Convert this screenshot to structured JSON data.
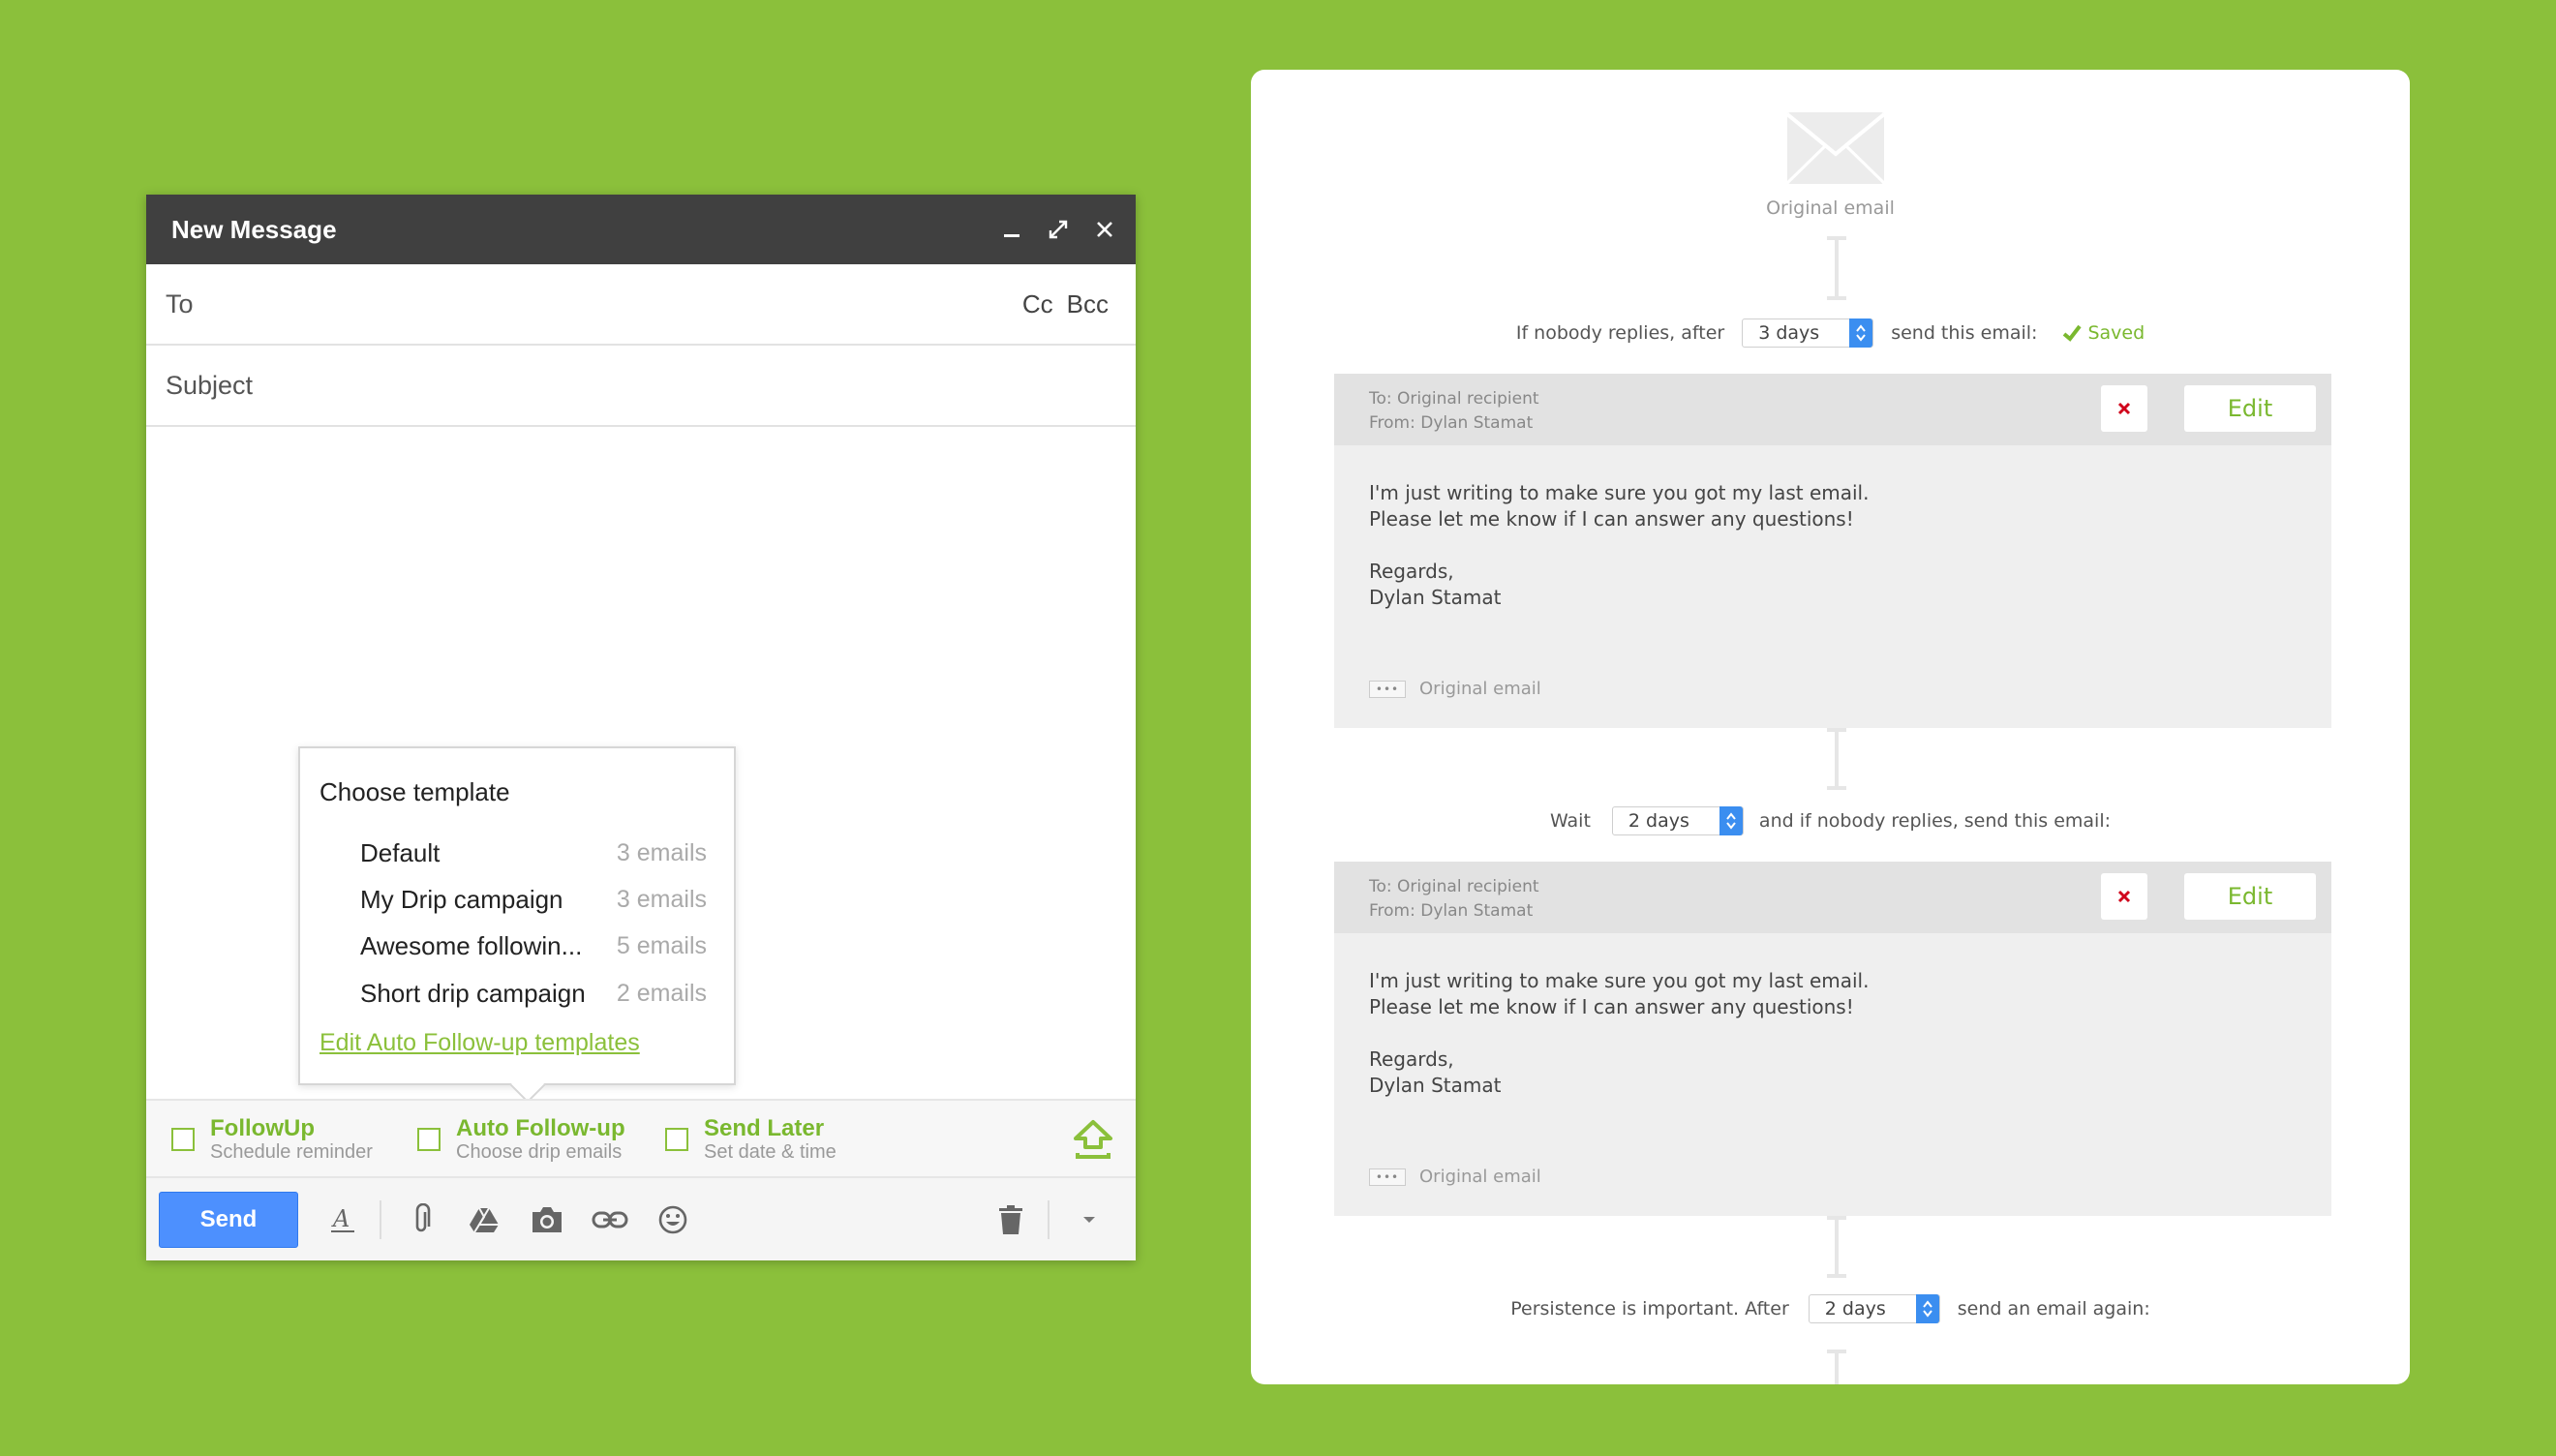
{
  "colors": {
    "background": "#8bc03b",
    "accent_green": "#7ab82f",
    "send_blue": "#4d90fe",
    "select_blue": "#3b8ef0",
    "delete_red": "#d0021b"
  },
  "compose": {
    "title": "New Message",
    "controls": [
      "minimize-icon",
      "expand-icon",
      "close-icon"
    ],
    "to_label": "To",
    "cc_label": "Cc",
    "bcc_label": "Bcc",
    "subject_placeholder": "Subject",
    "template_menu": {
      "title": "Choose template",
      "items": [
        {
          "name": "Default",
          "count": "3 emails"
        },
        {
          "name": "My Drip campaign",
          "count": "3 emails"
        },
        {
          "name": "Awesome followin...",
          "count": "5 emails"
        },
        {
          "name": "Short drip campaign",
          "count": "2 emails"
        }
      ],
      "edit_link": "Edit Auto Follow-up templates"
    },
    "options": [
      {
        "title": "FollowUp",
        "subtitle": "Schedule reminder"
      },
      {
        "title": "Auto Follow-up",
        "subtitle": "Choose drip emails"
      },
      {
        "title": "Send Later",
        "subtitle": "Set date & time"
      }
    ],
    "send_label": "Send",
    "toolbar_icons": [
      "text-format-icon",
      "attach-icon",
      "drive-icon",
      "photo-icon",
      "link-icon",
      "emoji-icon",
      "trash-icon",
      "more-options-icon"
    ]
  },
  "sequence": {
    "original_label": "Original email",
    "step1": {
      "before": "If nobody replies, after",
      "select": "3 days",
      "after": "send this email:",
      "saved": "Saved"
    },
    "email1": {
      "to": "To: Original recipient",
      "from": "From: Dylan Stamat",
      "edit": "Edit",
      "line1": "I'm just writing to make sure you got my last email.",
      "line2": "Please let me know if I can answer any questions!",
      "line3": "Regards,",
      "line4": "Dylan Stamat",
      "footer": "Original email"
    },
    "step2": {
      "before": "Wait",
      "select": "2 days",
      "after": "and if nobody replies, send this email:"
    },
    "email2": {
      "to": "To: Original recipient",
      "from": "From: Dylan Stamat",
      "edit": "Edit",
      "line1": "I'm just writing to make sure you got my last email.",
      "line2": "Please let me know if I can answer any questions!",
      "line3": "Regards,",
      "line4": "Dylan Stamat",
      "footer": "Original email"
    },
    "step3": {
      "before": "Persistence is important. After",
      "select": "2 days",
      "after": "send an email again:"
    }
  }
}
